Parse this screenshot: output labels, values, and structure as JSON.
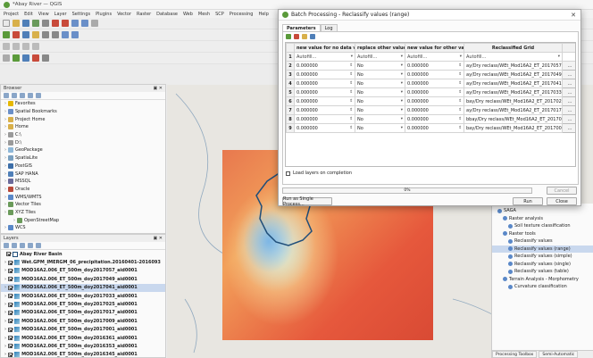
{
  "app": {
    "window_title": "*Abay River — QGIS",
    "menu": [
      "Project",
      "Edit",
      "View",
      "Layer",
      "Settings",
      "Plugins",
      "Vector",
      "Raster",
      "Database",
      "Web",
      "Mesh",
      "SCP",
      "Processing",
      "Help"
    ]
  },
  "browser": {
    "title": "Browser",
    "items": [
      {
        "label": "Favorites",
        "icon": "star-icon",
        "color": "#e6b800"
      },
      {
        "label": "Spatial Bookmarks",
        "icon": "bookmark-icon",
        "color": "#6a8fc8"
      },
      {
        "label": "Project Home",
        "icon": "folder-icon",
        "color": "#d8b04a"
      },
      {
        "label": "Home",
        "icon": "folder-icon",
        "color": "#d8b04a"
      },
      {
        "label": "C:\\",
        "icon": "drive-icon",
        "color": "#9a9a9a"
      },
      {
        "label": "D:\\",
        "icon": "drive-icon",
        "color": "#9a9a9a"
      },
      {
        "label": "GeoPackage",
        "icon": "geopackage-icon",
        "color": "#8fb8d8"
      },
      {
        "label": "SpatiaLite",
        "icon": "spatialite-icon",
        "color": "#7aa0c0"
      },
      {
        "label": "PostGIS",
        "icon": "postgis-icon",
        "color": "#3c6ea8"
      },
      {
        "label": "SAP HANA",
        "icon": "database-icon",
        "color": "#4f7fb8"
      },
      {
        "label": "MSSQL",
        "icon": "database-icon",
        "color": "#6a6a9a"
      },
      {
        "label": "Oracle",
        "icon": "database-icon",
        "color": "#b84a3a"
      },
      {
        "label": "WMS/WMTS",
        "icon": "globe-icon",
        "color": "#5a88c8"
      },
      {
        "label": "Vector Tiles",
        "icon": "grid-icon",
        "color": "#6a9a5a"
      },
      {
        "label": "XYZ Tiles",
        "icon": "grid-icon",
        "color": "#6a9a5a"
      },
      {
        "label": "OpenStreetMap",
        "icon": "grid-icon",
        "color": "#6a9a5a"
      },
      {
        "label": "WCS",
        "icon": "globe-icon",
        "color": "#5a88c8"
      }
    ]
  },
  "layers": {
    "title": "Layers",
    "items": [
      {
        "label": "Abay River Basin",
        "selected": false
      },
      {
        "label": "Wet.GPM_IMERGM_06_precipitation.20160401-2016093",
        "selected": false
      },
      {
        "label": "MOD16A2.006_ET_500m_doy2017057_aid0001",
        "selected": false
      },
      {
        "label": "MOD16A2.006_ET_500m_doy2017049_aid0001",
        "selected": false
      },
      {
        "label": "MOD16A2.006_ET_500m_doy2017041_aid0001",
        "selected": true
      },
      {
        "label": "MOD16A2.006_ET_500m_doy2017033_aid0001",
        "selected": false
      },
      {
        "label": "MOD16A2.006_ET_500m_doy2017025_aid0001",
        "selected": false
      },
      {
        "label": "MOD16A2.006_ET_500m_doy2017017_aid0001",
        "selected": false
      },
      {
        "label": "MOD16A2.006_ET_500m_doy2017009_aid0001",
        "selected": false
      },
      {
        "label": "MOD16A2.006_ET_500m_doy2017001_aid0001",
        "selected": false
      },
      {
        "label": "MOD16A2.006_ET_500m_doy2016361_aid0001",
        "selected": false
      },
      {
        "label": "MOD16A2.006_ET_500m_doy2016353_aid0001",
        "selected": false
      },
      {
        "label": "MOD16A2.006_ET_500m_doy2016345_aid0001",
        "selected": false
      }
    ]
  },
  "dialog": {
    "title": "Batch Processing - Reclassify values (range)",
    "tabs": [
      "Parameters",
      "Log"
    ],
    "columns": [
      "new value for no data values",
      "replace other values",
      "new value for other values",
      "Reclassified Grid"
    ],
    "autofill": "Autofill...",
    "rows": [
      {
        "n": "2",
        "nodata": "0.000000",
        "replace": "No",
        "other": "0.000000",
        "grid": "ay/Dry reclass/WEt_Mod16A2_ET_2017057.s"
      },
      {
        "n": "3",
        "nodata": "0.000000",
        "replace": "No",
        "other": "0.000000",
        "grid": "ay/Dry reclass/WEt_Mod16A2_ET_2017049.sd"
      },
      {
        "n": "4",
        "nodata": "0.000000",
        "replace": "No",
        "other": "0.000000",
        "grid": "ay/Dry reclass/WEt_Mod16A2_ET_2017041.sd"
      },
      {
        "n": "5",
        "nodata": "0.000000",
        "replace": "No",
        "other": "0.000000",
        "grid": "ay/Dry reclass/WEt_Mod16A2_ET_2017033.sd"
      },
      {
        "n": "6",
        "nodata": "0.000000",
        "replace": "No",
        "other": "0.000000",
        "grid": "bay/Dry reclass/WEt_Mod16A2_ET_2017025.s"
      },
      {
        "n": "7",
        "nodata": "0.000000",
        "replace": "No",
        "other": "0.000000",
        "grid": "ay/Dry reclass/WEt_Mod16A2_ET_2017017.sd"
      },
      {
        "n": "8",
        "nodata": "0.000000",
        "replace": "No",
        "other": "0.000000",
        "grid": "bbay/Dry reclass/WEt_Mod16A2_ET_2017009."
      },
      {
        "n": "9",
        "nodata": "0.000000",
        "replace": "No",
        "other": "0.000000",
        "grid": "bay/Dry reclass/WEt_Mod16A2_ET_2017001."
      }
    ],
    "load_layers_label": "Load layers on completion",
    "progress_text": "0%",
    "progress": 0,
    "cancel_label": "Cancel",
    "run_single_label": "Run as Single Process...",
    "run_label": "Run",
    "close_label": "Close"
  },
  "toolbox": {
    "items": [
      {
        "label": "SAGA",
        "active": false,
        "indent": 0
      },
      {
        "label": "Raster analysis",
        "active": false,
        "indent": 1
      },
      {
        "label": "Soil texture classification",
        "active": false,
        "indent": 2
      },
      {
        "label": "Raster tools",
        "active": false,
        "indent": 1
      },
      {
        "label": "Reclassify values",
        "active": false,
        "indent": 2
      },
      {
        "label": "Reclassify values (range)",
        "active": true,
        "indent": 2
      },
      {
        "label": "Reclassify values (simple)",
        "active": false,
        "indent": 2
      },
      {
        "label": "Reclassify values (single)",
        "active": false,
        "indent": 2
      },
      {
        "label": "Reclassify values (table)",
        "active": false,
        "indent": 2
      },
      {
        "label": "Terrain Analysis - Morphometry",
        "active": false,
        "indent": 1
      },
      {
        "label": "Curvature classification",
        "active": false,
        "indent": 2
      }
    ],
    "tabs": [
      "Processing Toolbox",
      "Semi-Automatic"
    ]
  },
  "colors": {
    "accent": "#3c6ea8",
    "selection": "#c9d8ee",
    "basin_outline": "#1f4e7a"
  }
}
